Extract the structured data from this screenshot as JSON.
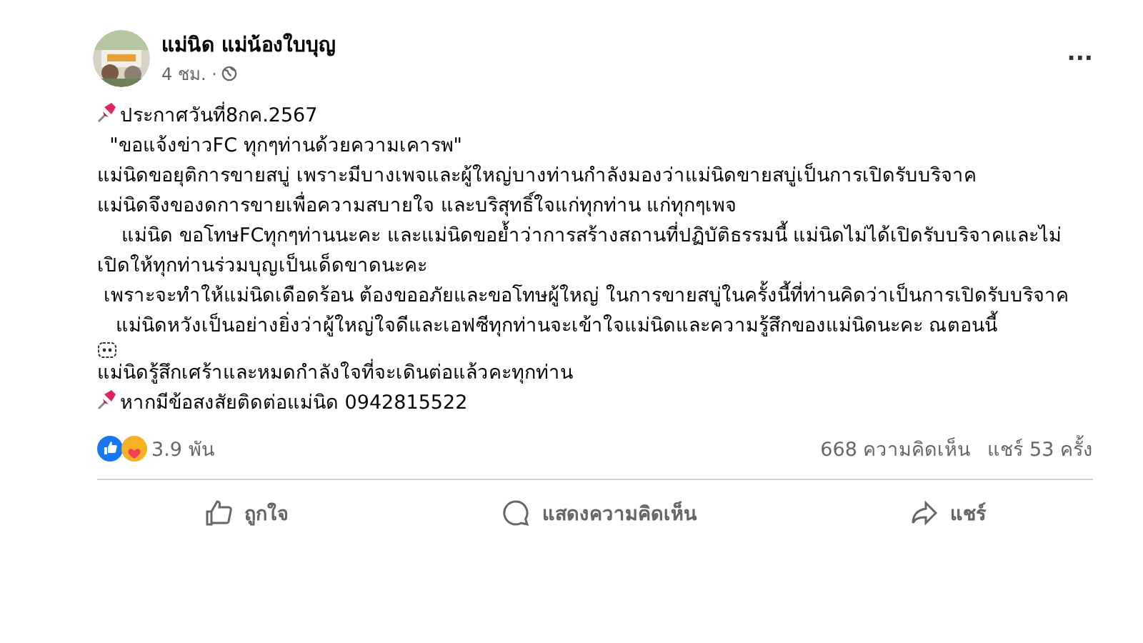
{
  "post": {
    "author": "แม่นิด แม่น้องใบบุญ",
    "time": "4 ชม. ·",
    "more": "···",
    "paragraphs": [
      {
        "kind": "pinned",
        "text": "ประกาศวันที่8กค.2567"
      },
      {
        "kind": "plain",
        "text": "  \"ขอแจ้งข่าวFC ทุกๆท่านด้วยความเคารพ\""
      },
      {
        "kind": "plain",
        "text": "แม่นิดขอยุติการขายสบู่ เพราะมีบางเพจและผู้ใหญ่บางท่านกำลังมองว่าแม่นิดขายสบู่เป็นการเปิดรับบริจาค"
      },
      {
        "kind": "plain",
        "text": "แม่นิดจึงของดการขายเพื่อความสบายใจ และบริสุทธิ์ใจแก่ทุกท่าน แก่ทุกๆเพจ"
      },
      {
        "kind": "plain",
        "text": "    แม่นิด ขอโทษFCทุกๆท่านนะคะ และแม่นิดขอย้ำว่าการสร้างสถานที่ปฏิบัติธรรมนี้ แม่นิดไม่ได้เปิดรับบริจาคและไม่เปิดให้ทุกท่านร่วมบุญเป็นเด็ดขาดนะคะ"
      },
      {
        "kind": "plain",
        "text": " เพราะจะทำให้แม่นิดเดือดร้อน ต้องขออภัยและขอโทษผู้ใหญ่ ในการขายสบู่ในครั้งนี้ที่ท่านคิดว่าเป็นการเปิดรับบริจาค"
      },
      {
        "kind": "emoji_end",
        "text": "   แม่นิดหวังเป็นอย่างยิ่งว่าผู้ใหญ่ใจดีและเอฟซีทุกท่านจะเข้าใจแม่นิดและความรู้สึกของแม่นิดนะคะ ณตอนนี้"
      },
      {
        "kind": "plain",
        "text": "แม่นิดรู้สึกเศร้าและหมดกำลังใจที่จะเดินต่อแล้วคะทุกท่าน"
      },
      {
        "kind": "pinned",
        "text": "หากมีข้อสงสัยติดต่อแม่นิด 0942815522"
      }
    ],
    "reactions": "3.9 พัน",
    "comments": "668 ความคิดเห็น",
    "shares": "แชร์ 53 ครั้ง",
    "actions": [
      {
        "kind": "like",
        "label": "ถูกใจ"
      },
      {
        "kind": "comment",
        "label": "แสดงความคิดเห็น"
      },
      {
        "kind": "share",
        "label": "แชร์"
      }
    ]
  }
}
